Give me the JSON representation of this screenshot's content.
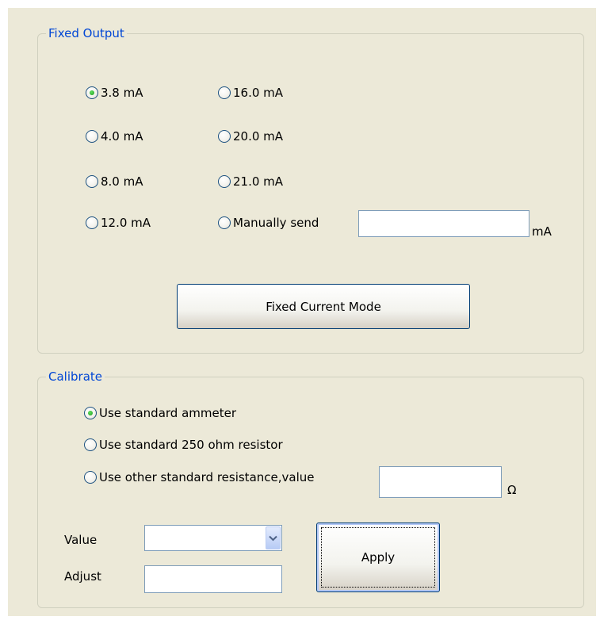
{
  "fixed_output": {
    "title": "Fixed Output",
    "options": [
      {
        "label": "3.8 mA",
        "checked": true
      },
      {
        "label": "16.0 mA",
        "checked": false
      },
      {
        "label": "4.0 mA",
        "checked": false
      },
      {
        "label": "20.0 mA",
        "checked": false
      },
      {
        "label": "8.0 mA",
        "checked": false
      },
      {
        "label": "21.0 mA",
        "checked": false
      },
      {
        "label": "12.0 mA",
        "checked": false
      },
      {
        "label": "Manually send",
        "checked": false
      }
    ],
    "manual_value": "",
    "manual_unit": "mA",
    "button_label": "Fixed Current Mode"
  },
  "calibrate": {
    "title": "Calibrate",
    "options": [
      {
        "label": "Use standard ammeter",
        "checked": true
      },
      {
        "label": "Use standard 250 ohm resistor",
        "checked": false
      },
      {
        "label": "Use other standard resistance,value",
        "checked": false
      }
    ],
    "resistance_value": "",
    "resistance_unit": "Ω",
    "value_label": "Value",
    "value_selected": "",
    "adjust_label": "Adjust",
    "adjust_value": "",
    "apply_label": "Apply"
  },
  "icons": {
    "combo_arrow": "chevron-down-icon"
  }
}
